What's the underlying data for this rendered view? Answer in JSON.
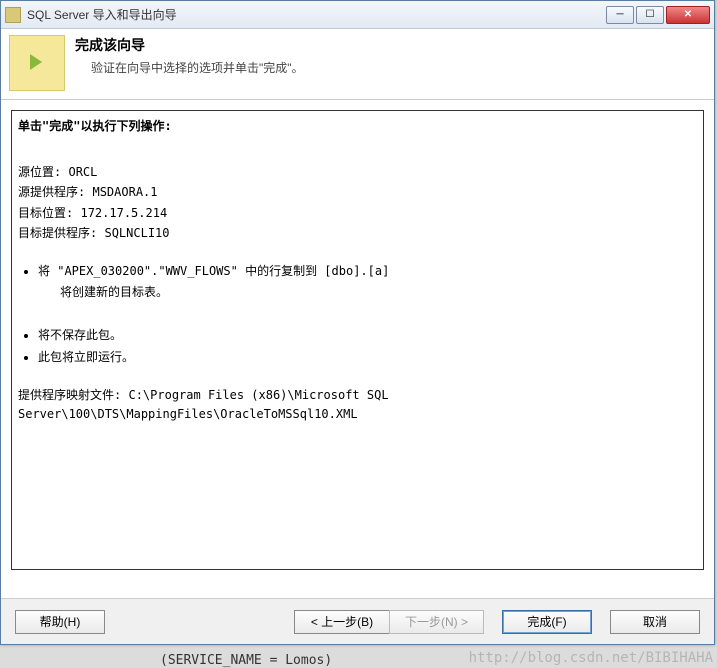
{
  "window": {
    "title": "SQL Server 导入和导出向导"
  },
  "header": {
    "heading": "完成该向导",
    "subtitle": "验证在向导中选择的选项并单击\"完成\"。"
  },
  "content": {
    "section_title": "单击\"完成\"以执行下列操作:",
    "source_location_label": "源位置:",
    "source_location_value": "ORCL",
    "source_provider_label": "源提供程序:",
    "source_provider_value": "MSDAORA.1",
    "dest_location_label": "目标位置:",
    "dest_location_value": "172.17.5.214",
    "dest_provider_label": "目标提供程序:",
    "dest_provider_value": "SQLNCLI10",
    "copy_line": "将 \"APEX_030200\".\"WWV_FLOWS\" 中的行复制到 [dbo].[a]",
    "copy_sub": "将创建新的目标表。",
    "nosave_line": "将不保存此包。",
    "runnow_line": "此包将立即运行。",
    "mapping_label": "提供程序映射文件:",
    "mapping_value": "C:\\Program Files (x86)\\Microsoft SQL Server\\100\\DTS\\MappingFiles\\OracleToMSSql10.XML"
  },
  "buttons": {
    "help": "帮助(H)",
    "back": "< 上一步(B)",
    "next": "下一步(N) >",
    "finish": "完成(F)",
    "cancel": "取消"
  },
  "watermark": "http://blog.csdn.net/BIBIHAHA",
  "footer_leak": "(SERVICE_NAME = Lomos)"
}
